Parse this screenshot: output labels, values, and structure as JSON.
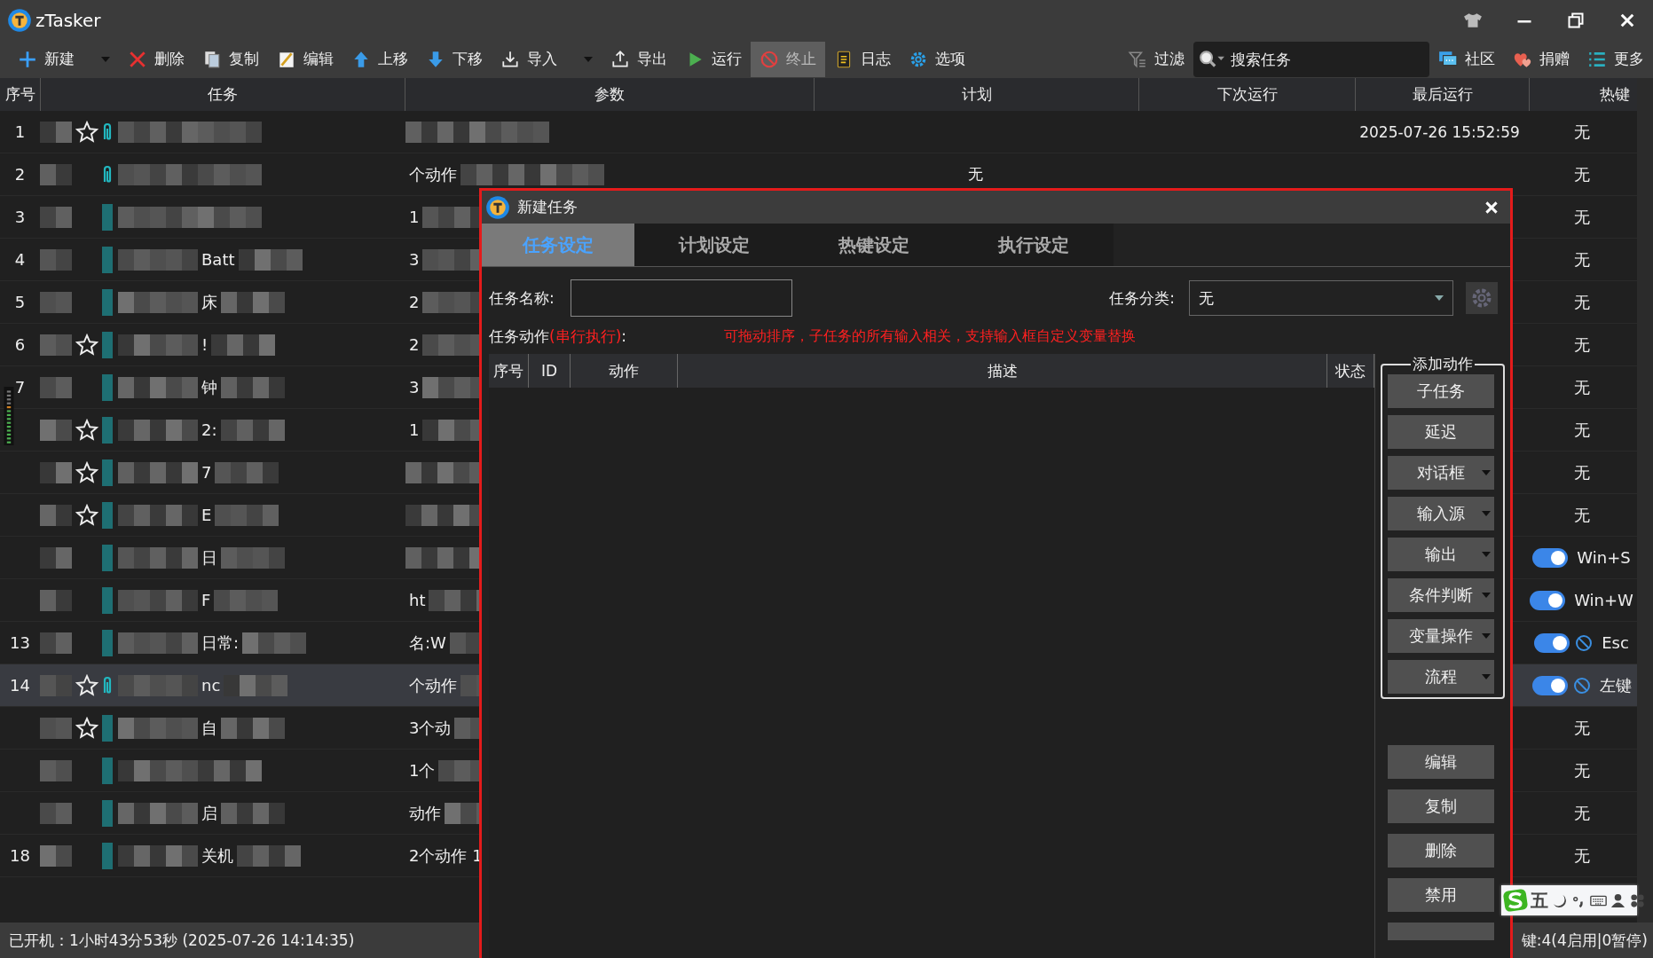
{
  "window": {
    "title": "zTasker"
  },
  "toolbar": [
    {
      "kind": "add",
      "label": "新建",
      "dropdown": true,
      "disabled": false
    },
    {
      "kind": "delete",
      "label": "删除",
      "dropdown": false,
      "disabled": false
    },
    {
      "kind": "copy",
      "label": "复制",
      "dropdown": false,
      "disabled": false
    },
    {
      "kind": "edit",
      "label": "编辑",
      "dropdown": false,
      "disabled": false
    },
    {
      "kind": "up",
      "label": "上移",
      "dropdown": false,
      "disabled": false
    },
    {
      "kind": "down",
      "label": "下移",
      "dropdown": false,
      "disabled": false
    },
    {
      "kind": "import",
      "label": "导入",
      "dropdown": true,
      "disabled": false
    },
    {
      "kind": "export",
      "label": "导出",
      "dropdown": false,
      "disabled": false
    },
    {
      "kind": "run",
      "label": "运行",
      "dropdown": false,
      "disabled": false
    },
    {
      "kind": "stop",
      "label": "终止",
      "dropdown": false,
      "disabled": true
    },
    {
      "kind": "log",
      "label": "日志",
      "dropdown": false,
      "disabled": false
    },
    {
      "kind": "options",
      "label": "选项",
      "dropdown": false,
      "disabled": false
    }
  ],
  "filter": {
    "label": "过滤"
  },
  "search": {
    "placeholder": "搜索任务"
  },
  "toolbar_right": [
    {
      "kind": "community",
      "label": "社区"
    },
    {
      "kind": "donate",
      "label": "捐赠"
    },
    {
      "kind": "more",
      "label": "更多"
    }
  ],
  "table": {
    "columns": [
      "序号",
      "任务",
      "参数",
      "计划",
      "下次运行",
      "最后运行",
      "热键"
    ],
    "rows": [
      {
        "no": "1",
        "star": true,
        "link": true,
        "selected": false,
        "last_run": "2025-07-26 15:52:59",
        "hotkey": {
          "kind": "none",
          "label": "无"
        }
      },
      {
        "no": "2",
        "star": false,
        "link": true,
        "selected": false,
        "params": "个动作",
        "schedule": "无",
        "hotkey": {
          "kind": "none",
          "label": "无"
        }
      },
      {
        "no": "3",
        "star": false,
        "link": false,
        "selected": false,
        "params": "1",
        "hotkey": {
          "kind": "none",
          "label": "无"
        }
      },
      {
        "no": "4",
        "star": false,
        "link": false,
        "selected": false,
        "task": "Batt",
        "params": "3",
        "hotkey": {
          "kind": "none",
          "label": "无"
        }
      },
      {
        "no": "5",
        "star": false,
        "link": false,
        "selected": false,
        "task": "床",
        "params": "2",
        "hotkey": {
          "kind": "none",
          "label": "无"
        }
      },
      {
        "no": "6",
        "star": true,
        "link": false,
        "selected": false,
        "task": "!",
        "params": "2",
        "hotkey": {
          "kind": "none",
          "label": "无"
        }
      },
      {
        "no": "7",
        "star": false,
        "link": false,
        "selected": false,
        "task": "钟",
        "params": "3",
        "hotkey": {
          "kind": "none",
          "label": "无"
        }
      },
      {
        "star": true,
        "link": false,
        "selected": false,
        "task": "2:",
        "params": "1",
        "hotkey": {
          "kind": "none",
          "label": "无"
        }
      },
      {
        "star": true,
        "link": false,
        "selected": false,
        "task": "7",
        "hotkey": {
          "kind": "none",
          "label": "无"
        }
      },
      {
        "star": true,
        "link": false,
        "selected": false,
        "task": "E",
        "hotkey": {
          "kind": "none",
          "label": "无"
        }
      },
      {
        "star": false,
        "link": false,
        "selected": false,
        "task": "日",
        "hotkey": {
          "kind": "toggle",
          "on": true,
          "blocked": false,
          "label": "Win+S"
        }
      },
      {
        "star": false,
        "link": false,
        "selected": false,
        "task": "F",
        "params": "ht",
        "hotkey": {
          "kind": "toggle",
          "on": true,
          "blocked": false,
          "label": "Win+W"
        }
      },
      {
        "no": "13",
        "star": false,
        "link": false,
        "selected": false,
        "task": "日常:",
        "params": "名:W",
        "hotkey": {
          "kind": "toggle",
          "on": true,
          "blocked": true,
          "label": "Esc"
        }
      },
      {
        "no": "14",
        "star": true,
        "link": true,
        "selected": true,
        "task": "nc",
        "params": "个动作",
        "hotkey": {
          "kind": "toggle",
          "on": true,
          "blocked": true,
          "label": "左键"
        }
      },
      {
        "star": true,
        "link": false,
        "selected": false,
        "task": "自",
        "params": "3个动",
        "hotkey": {
          "kind": "none",
          "label": "无"
        }
      },
      {
        "star": false,
        "link": false,
        "selected": false,
        "params": "1个",
        "hotkey": {
          "kind": "none",
          "label": "无"
        }
      },
      {
        "star": false,
        "link": false,
        "selected": false,
        "task": "启",
        "params": "动作",
        "hotkey": {
          "kind": "none",
          "label": "无"
        }
      },
      {
        "no": "18",
        "star": false,
        "link": false,
        "selected": false,
        "task": "关机",
        "params": "2个动作 1",
        "hotkey": {
          "kind": "none",
          "label": "无"
        }
      }
    ]
  },
  "status_bar": {
    "uptime": "已开机：1小时43分53秒 (2025-07-26 14:14:35)",
    "hotkeys": "键:4(4启用|0暂停)"
  },
  "ime_bar": {
    "mode": "五"
  },
  "dialog": {
    "title": "新建任务",
    "tabs": [
      {
        "label": "任务设定",
        "selected": true
      },
      {
        "label": "计划设定",
        "selected": false
      },
      {
        "label": "热键设定",
        "selected": false
      },
      {
        "label": "执行设定",
        "selected": false
      }
    ],
    "name_label": "任务名称:",
    "category_label": "任务分类:",
    "category": "无",
    "actions_label": "任务动作",
    "actions_mode": "(串行执行)",
    "actions_colon": ":",
    "hint": "可拖动排序，子任务的所有输入相关，支持输入框自定义变量替换",
    "columns": [
      "序号",
      "ID",
      "动作",
      "描述",
      "状态"
    ],
    "add_group": "添加动作",
    "add_buttons": [
      {
        "label": "子任务",
        "dropdown": false
      },
      {
        "label": "延迟",
        "dropdown": false
      },
      {
        "label": "对话框",
        "dropdown": true
      },
      {
        "label": "输入源",
        "dropdown": true
      },
      {
        "label": "输出",
        "dropdown": true
      },
      {
        "label": "条件判断",
        "dropdown": true
      },
      {
        "label": "变量操作",
        "dropdown": true
      },
      {
        "label": "流程",
        "dropdown": true
      }
    ],
    "edit_buttons": [
      "编辑",
      "复制",
      "删除",
      "禁用"
    ]
  }
}
